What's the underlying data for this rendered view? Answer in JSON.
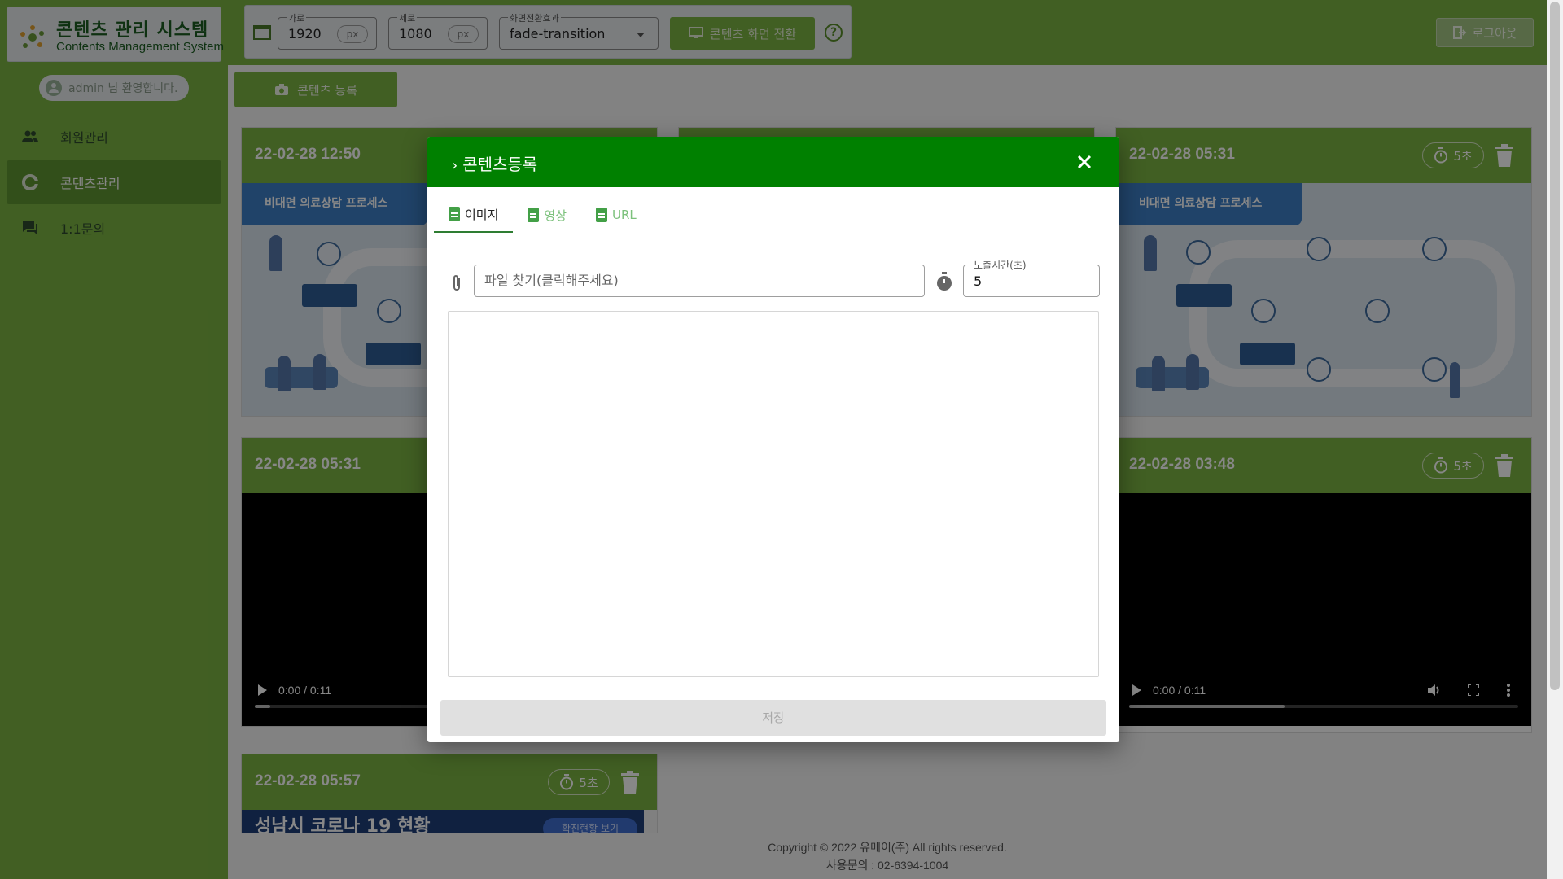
{
  "brand": {
    "title": "콘텐츠 관리 시스템",
    "subtitle": "Contents Management System"
  },
  "welcome": "admin 님 환영합니다.",
  "sidebar": {
    "items": [
      {
        "label": "회원관리",
        "icon": "group-icon",
        "active": false
      },
      {
        "label": "콘텐츠관리",
        "icon": "contents-icon",
        "active": true
      },
      {
        "label": "1:1문의",
        "icon": "chat-icon",
        "active": false
      }
    ]
  },
  "toolbar": {
    "width_label": "가로",
    "width_value": "1920",
    "width_unit": "px",
    "height_label": "세로",
    "height_value": "1080",
    "height_unit": "px",
    "effect_label": "화면전환효과",
    "effect_value": "fade-transition",
    "switch_label": "콘텐츠 화면 전환",
    "help": "?"
  },
  "logout_label": "로그아웃",
  "register_label": "콘텐츠 등록",
  "cards": [
    {
      "date": "22-02-28 12:50",
      "type": "image"
    },
    {
      "date": "22-02-28 05:31",
      "type": "image",
      "timer": "5초"
    },
    {
      "date": "22-02-28 05:31",
      "type": "video"
    },
    {
      "date": "22-02-28 03:48",
      "type": "video",
      "timer": "5초"
    },
    {
      "date": "22-02-28 05:57",
      "type": "image",
      "timer": "5초"
    }
  ],
  "image_banner": "비대면 의료상담 프로세스",
  "video": {
    "time": "0:00 / 0:11",
    "progress": 0.4
  },
  "news": {
    "title": "성남시 코로나 19 현황",
    "pill": "확진현황 보기"
  },
  "footer": {
    "copyright": "Copyright © 2022 유메이(주) All rights reserved.",
    "contact": "사용문의 : 02-6394-1004"
  },
  "modal": {
    "title": "콘텐츠등록",
    "tabs": [
      {
        "label": "이미지",
        "active": true
      },
      {
        "label": "영상",
        "active": false
      },
      {
        "label": "URL",
        "active": false
      }
    ],
    "file_placeholder": "파일 찾기(클릭해주세요)",
    "time_label": "노출시간(초)",
    "time_value": "5",
    "save_label": "저장"
  },
  "colors": {
    "brand_green": "#7cb342",
    "modal_header": "#008000",
    "dark_text": "#1b5e20"
  }
}
